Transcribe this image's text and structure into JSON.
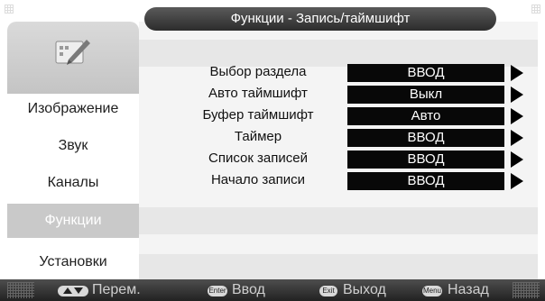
{
  "header": {
    "title": "Функции - Запись/таймшифт"
  },
  "sidebar": {
    "items": [
      {
        "label": "Изображение",
        "active": false
      },
      {
        "label": "Звук",
        "active": false
      },
      {
        "label": "Каналы",
        "active": false
      },
      {
        "label": "Функции",
        "active": true
      },
      {
        "label": "Установки",
        "active": false
      }
    ]
  },
  "menu": {
    "rows": [
      {
        "label": "Выбор раздела",
        "value": "ВВОД"
      },
      {
        "label": "Авто таймшифт",
        "value": "Выкл"
      },
      {
        "label": "Буфер таймшифт",
        "value": "Авто"
      },
      {
        "label": "Таймер",
        "value": "ВВОД"
      },
      {
        "label": "Список записей",
        "value": "ВВОД"
      },
      {
        "label": "Начало записи",
        "value": "ВВОД"
      }
    ]
  },
  "footer": {
    "hints": [
      {
        "key": "updown",
        "label": "Перем."
      },
      {
        "key": "Enter",
        "label": "Ввод"
      },
      {
        "key": "Exit",
        "label": "Выход"
      },
      {
        "key": "Menu",
        "label": "Назад"
      }
    ]
  },
  "colors": {
    "value_box": "#080808",
    "active_sidebar": "#c9c9c9",
    "title_pill": "#3a3a3a"
  }
}
